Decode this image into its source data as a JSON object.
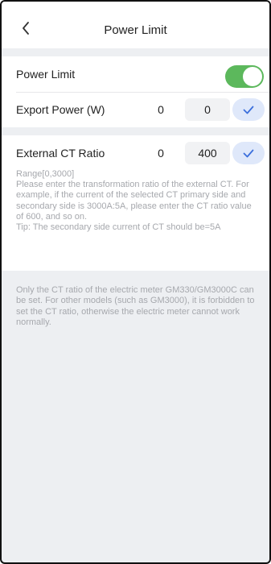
{
  "header": {
    "title": "Power Limit",
    "back_icon": "chevron-left-icon"
  },
  "power_limit": {
    "label": "Power Limit",
    "enabled": true,
    "toggle_color": "#5cb85c"
  },
  "export_power": {
    "label": "Export Power (W)",
    "current_value": "0",
    "input_value": "0"
  },
  "ct_ratio": {
    "label": "External CT Ratio",
    "current_value": "0",
    "input_value": "400",
    "range": "Range[0,3000]",
    "description": "Please enter the transformation ratio of the external CT. For example, if the current of the selected CT primary side and secondary side is 3000A:5A, please enter the CT ratio value of 600, and so on.",
    "tip": "Tip: The secondary side current of CT should be=5A"
  },
  "note": "Only the CT ratio of the electric meter GM330/GM3000C can be set. For other models (such as GM3000), it is forbidden to set the CT ratio, otherwise the electric meter cannot work normally.",
  "colors": {
    "background": "#edeff2",
    "accent": "#3b6fdc",
    "confirm_bg": "#dfe8fa",
    "hint_text": "#a6a8ad"
  }
}
